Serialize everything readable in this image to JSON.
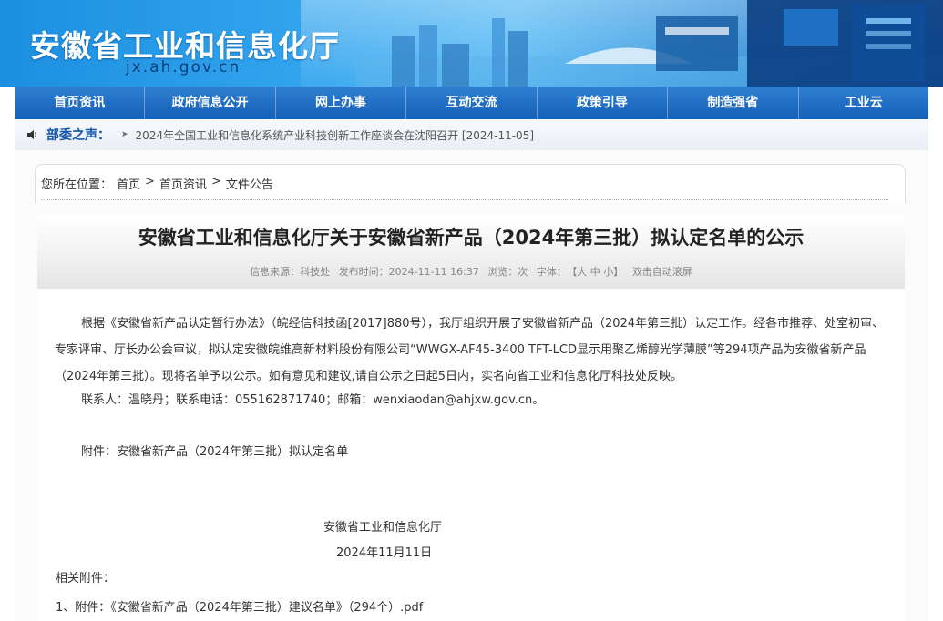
{
  "header": {
    "site_title": "安徽省工业和信息化厅",
    "site_domain": "jx.ah.gov.cn"
  },
  "nav": {
    "items": [
      "首页资讯",
      "政府信息公开",
      "网上办事",
      "互动交流",
      "政策引导",
      "制造强省",
      "工业云"
    ]
  },
  "notice": {
    "label": "部委之声：",
    "arrow": "➤",
    "text": "2024年全国工业和信息化系统产业科技创新工作座谈会在沈阳召开 [2024-11-05]"
  },
  "breadcrumb": {
    "prefix": "您所在位置：",
    "items": [
      "首页",
      "首页资讯",
      "文件公告"
    ],
    "sep": ">"
  },
  "article": {
    "title": "安徽省工业和信息化厅关于安徽省新产品（2024年第三批）拟认定名单的公示",
    "meta": {
      "source": "信息来源：科技处",
      "time": "发布时间：2024-11-11 16:37",
      "views": "浏览：次",
      "font_label": "字体：",
      "font_sizes": "【大 中 小】",
      "autoscroll": "双击自动滚屏"
    },
    "body": "根据《安徽省新产品认定暂行办法》（皖经信科技函[2017]880号），我厅组织开展了安徽省新产品（2024年第三批）认定工作。经各市推荐、处室初审、专家评审、厅长办公会审议，拟认定安徽皖维高新材料股份有限公司“WWGX-AF45-3400 TFT-LCD显示用聚乙烯醇光学薄膜”等294项产品为安徽省新产品（2024年第三批）。现将名单予以公示。如有意见和建议,请自公示之日起5日内，实名向省工业和信息化厅科技处反映。",
    "contact": "联系人：温晓丹；联系电话：055162871740；邮箱：wenxiaodan@ahjxw.gov.cn。",
    "appendix": "附件：安徽省新产品（2024年第三批）拟认定名单",
    "signature_org": "安徽省工业和信息化厅",
    "signature_date": "2024年11月11日",
    "related_label": "相关附件：",
    "attachments": [
      "1、附件：《安徽省新产品（2024年第三批）建议名单》（294个）.pdf"
    ]
  },
  "colors": {
    "nav_bg": "#1a66be",
    "notice_label": "#1357ad",
    "banner_blue": "#2f9ee8"
  }
}
